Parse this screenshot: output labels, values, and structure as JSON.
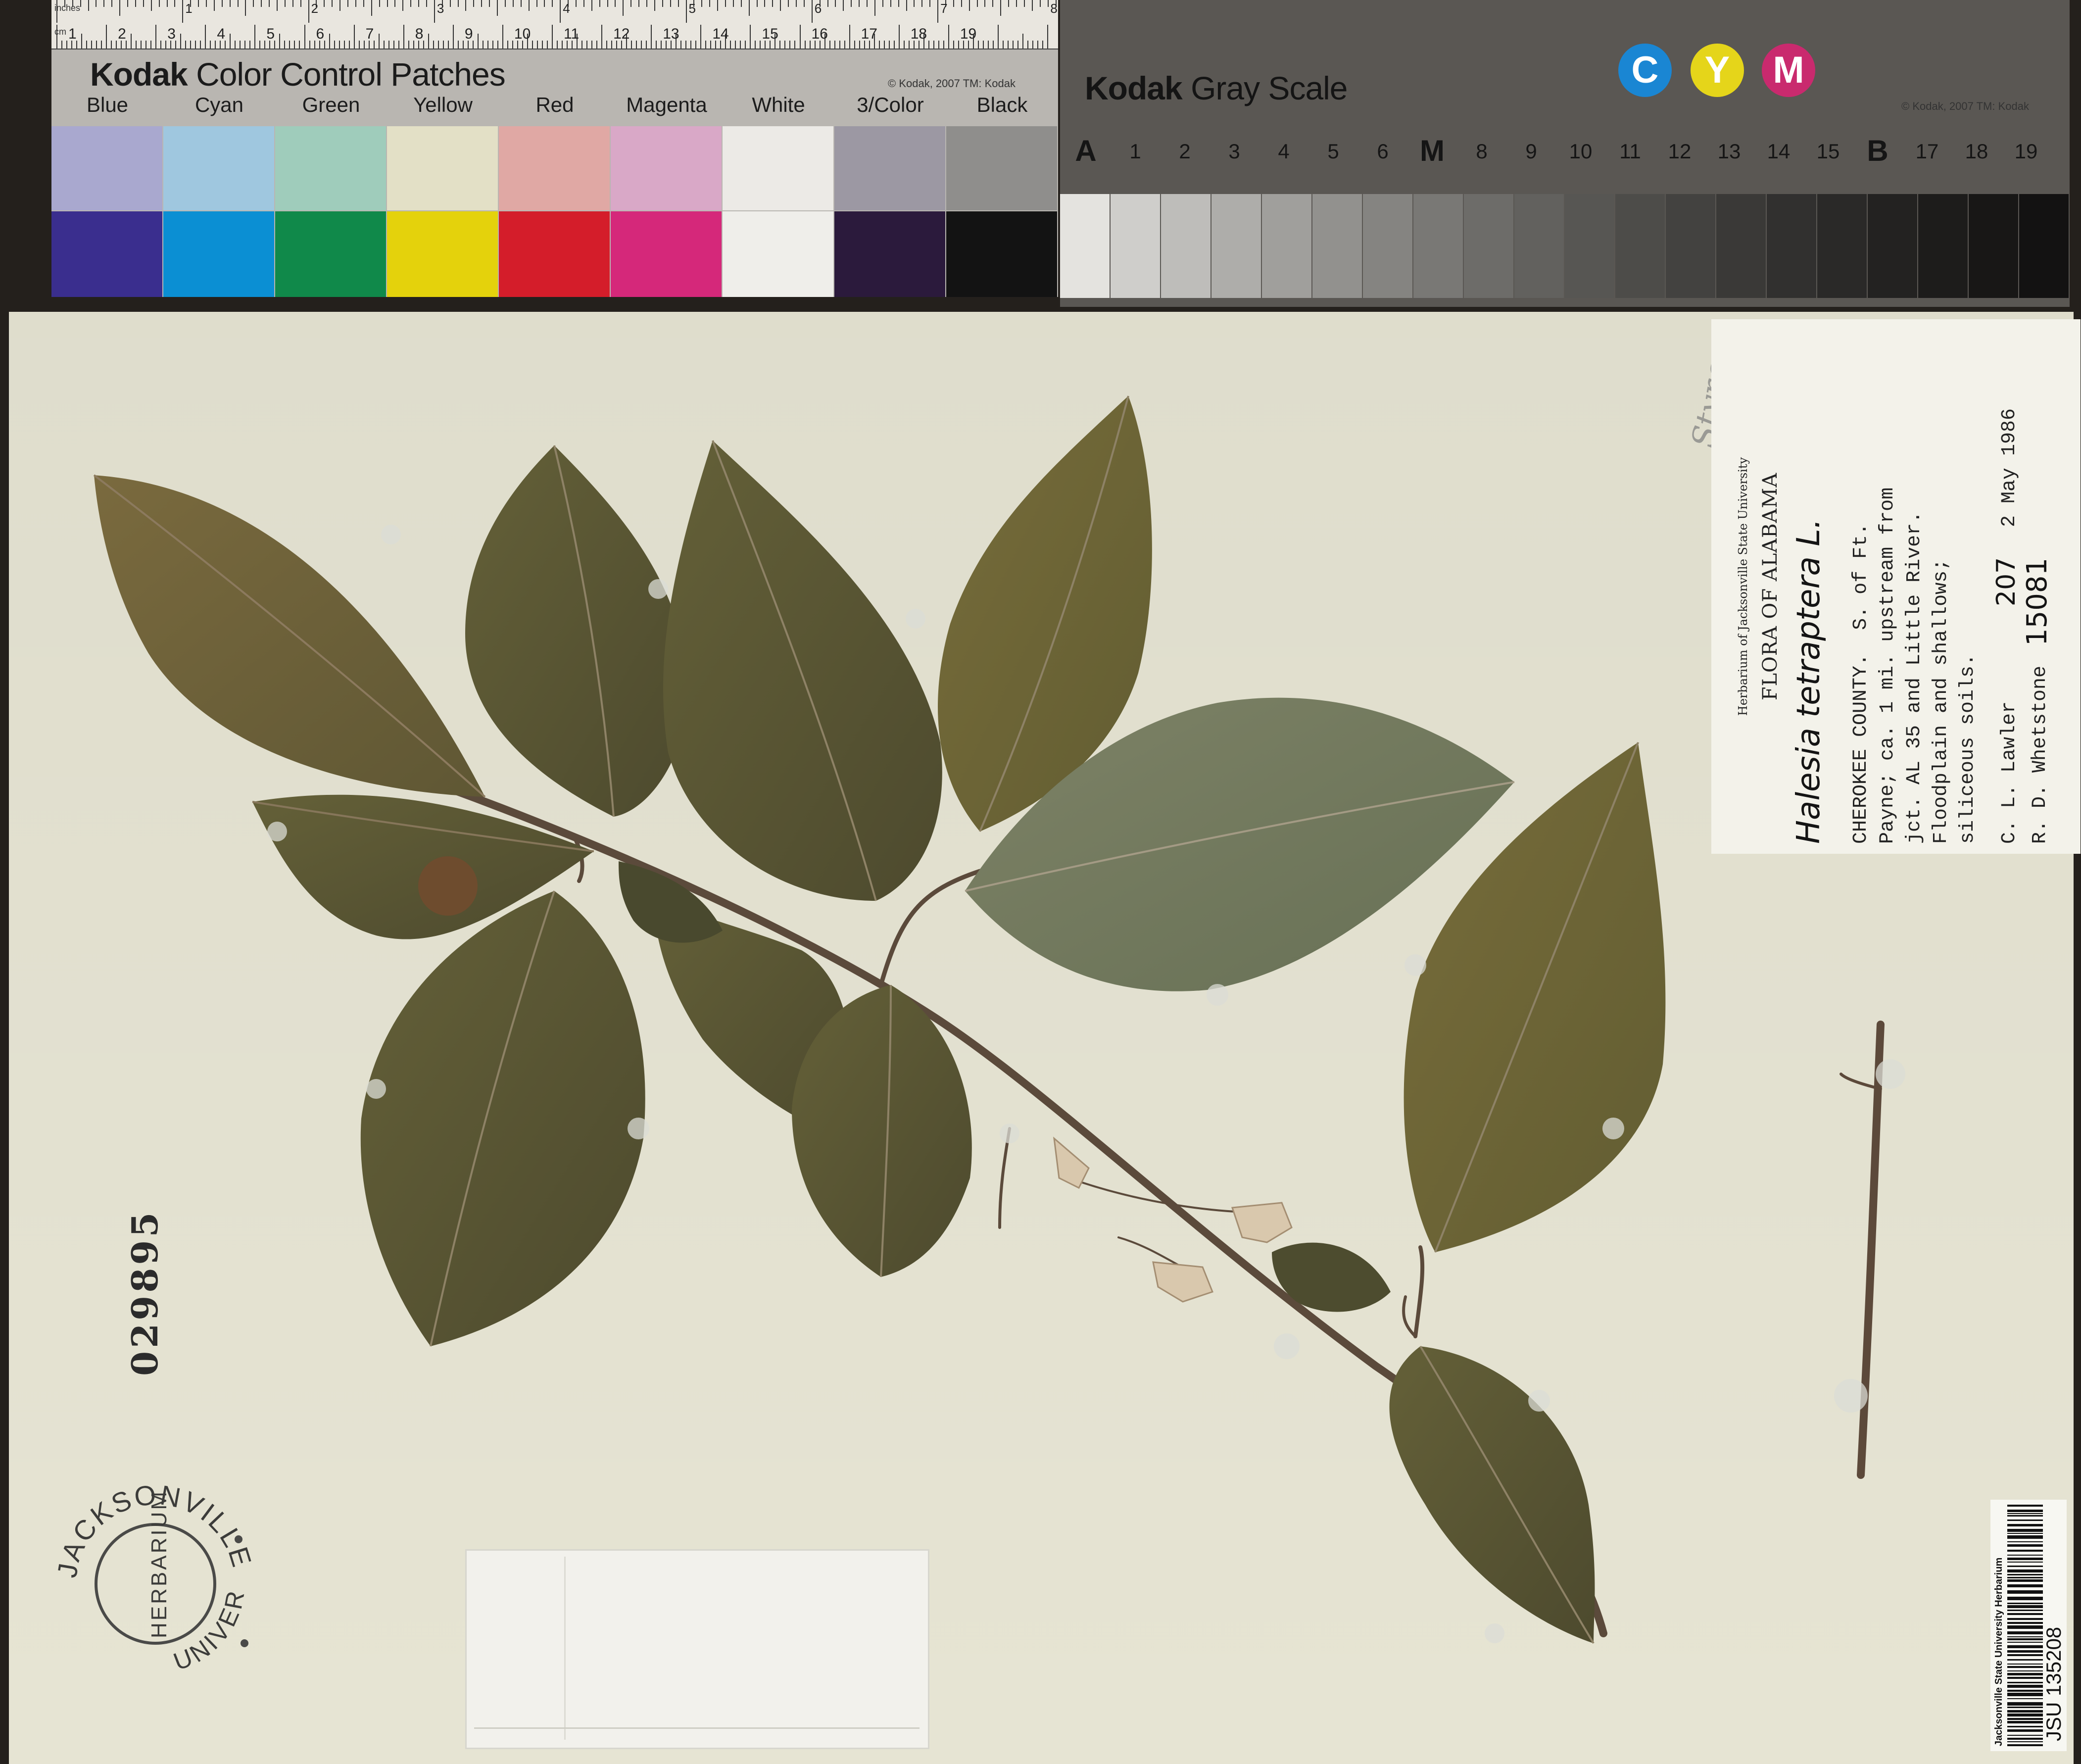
{
  "color_card": {
    "ruler": {
      "inches_label": "inches",
      "cm_label": "cm",
      "inch_numbers": [
        "1",
        "2",
        "3",
        "4",
        "5",
        "6",
        "7",
        "8"
      ],
      "cm_numbers": [
        "1",
        "2",
        "3",
        "4",
        "5",
        "6",
        "7",
        "8",
        "9",
        "10",
        "11",
        "12",
        "13",
        "14",
        "15",
        "16",
        "17",
        "18",
        "19"
      ]
    },
    "brand": "Kodak",
    "title": "Color Control Patches",
    "copyright": "© Kodak, 2007  TM: Kodak",
    "patches": [
      {
        "label": "Blue",
        "top": "#a9a8cf",
        "bottom": "#3a2e8e"
      },
      {
        "label": "Cyan",
        "top": "#9fc7df",
        "bottom": "#0b8fd3"
      },
      {
        "label": "Green",
        "top": "#9fccbb",
        "bottom": "#10894a"
      },
      {
        "label": "Yellow",
        "top": "#e3e0c6",
        "bottom": "#e4d20c"
      },
      {
        "label": "Red",
        "top": "#e0a8a4",
        "bottom": "#d41d2a"
      },
      {
        "label": "Magenta",
        "top": "#d9a8c7",
        "bottom": "#d5287a"
      },
      {
        "label": "White",
        "top": "#eceae6",
        "bottom": "#efeeea"
      },
      {
        "label": "3/Color",
        "top": "#9c98a3",
        "bottom": "#2b1a3c"
      },
      {
        "label": "Black",
        "top": "#8f8e8c",
        "bottom": "#131313"
      }
    ]
  },
  "gray_card": {
    "brand": "Kodak",
    "title": "Gray Scale",
    "copyright": "© Kodak, 2007  TM: Kodak",
    "cym": [
      {
        "letter": "C",
        "color": "#1a86d3"
      },
      {
        "letter": "Y",
        "color": "#e5d51a"
      },
      {
        "letter": "M",
        "color": "#c92a6e"
      }
    ],
    "steps": [
      "A",
      "1",
      "2",
      "3",
      "4",
      "5",
      "6",
      "M",
      "8",
      "9",
      "10",
      "11",
      "12",
      "13",
      "14",
      "15",
      "B",
      "17",
      "18",
      "19"
    ],
    "step_colors": [
      "#e4e3df",
      "#cfcecb",
      "#bebdba",
      "#aeadaa",
      "#a09f9c",
      "#92918e",
      "#858481",
      "#797875",
      "#6d6c69",
      "#62615e",
      "#575653",
      "#4d4c49",
      "#434240",
      "#3a3937",
      "#31302f",
      "#2a2928",
      "#232221",
      "#1d1c1b",
      "#181716",
      "#131212"
    ]
  },
  "label": {
    "herbarium": "Herbarium of Jacksonville State University",
    "flora": "FLORA OF ALABAMA",
    "taxon": "Halesia tetraptera L.",
    "locality": [
      "CHEROKEE COUNTY.  S. of Ft.",
      "Payne; ca. 1 mi. upstream from",
      "jct. AL 35 and Little River.",
      "Floodplain and shallows;",
      "siliceous soils."
    ],
    "collector_1": "C. L. Lawler",
    "collector_1_no": "207",
    "date": "2 May 1986",
    "collector_2": "R. D. Whetstone",
    "collector_2_no": "15081"
  },
  "annotation": "Styrac",
  "accession_number": "029895",
  "stamp": {
    "top_text": "JACKSONVILLE STATE",
    "bottom_text": "UNIVERSITY",
    "center_text": "HERBARIUM"
  },
  "barcode": {
    "institution": "Jacksonville State University Herbarium",
    "id": "JSU 135208"
  }
}
